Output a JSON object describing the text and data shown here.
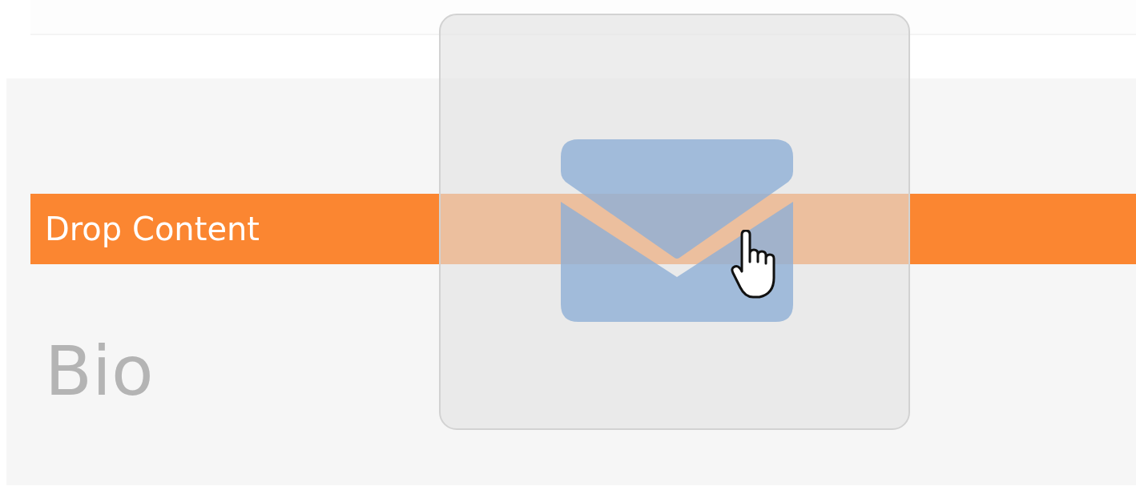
{
  "drop_zone": {
    "label": "Drop Content",
    "highlighted": true
  },
  "field": {
    "label": "Bio"
  }
}
